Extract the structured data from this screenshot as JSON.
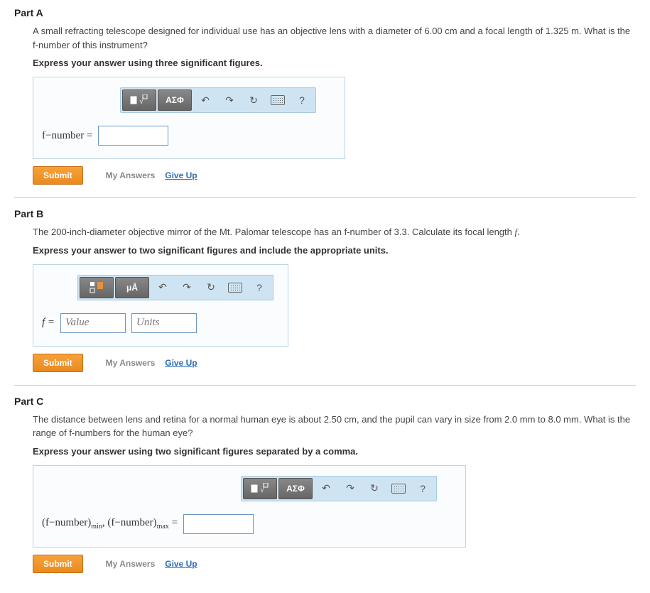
{
  "partA": {
    "title": "Part A",
    "question": "A small refracting telescope designed for individual use has an objective lens with a diameter of 6.00 cm and a focal length of 1.325 m. What is the f-number of this instrument?",
    "instruction": "Express your answer using three significant figures.",
    "label_html": "f−number =",
    "toolbar": {
      "math": "x√",
      "greek": "ΑΣΦ",
      "hint": "?"
    },
    "submit": "Submit",
    "my_answers": "My Answers",
    "give_up": "Give Up"
  },
  "partB": {
    "title": "Part B",
    "question_prefix": "The 200-inch-diameter objective mirror of the Mt. Palomar telescope has an f-number of 3.3. Calculate its focal length ",
    "question_var": "f",
    "question_suffix": ".",
    "instruction": "Express your answer to two significant figures and include the appropriate units.",
    "label": "f =",
    "value_ph": "Value",
    "units_ph": "Units",
    "toolbar": {
      "units": "μÅ",
      "hint": "?"
    },
    "submit": "Submit",
    "my_answers": "My Answers",
    "give_up": "Give Up"
  },
  "partC": {
    "title": "Part C",
    "question": "The distance between lens and retina for a normal human eye is about 2.50 cm, and the pupil can vary in size from 2.0 mm to 8.0 mm. What is the range of f-numbers for the human eye?",
    "instruction": "Express your answer using two significant figures separated by a comma.",
    "label_p1": "(f−number)",
    "label_sub1": "min",
    "label_sep": ", ",
    "label_p2": "(f−number)",
    "label_sub2": "max",
    "label_eq": " =",
    "toolbar": {
      "math": "x√",
      "greek": "ΑΣΦ",
      "hint": "?"
    },
    "submit": "Submit",
    "my_answers": "My Answers",
    "give_up": "Give Up"
  }
}
